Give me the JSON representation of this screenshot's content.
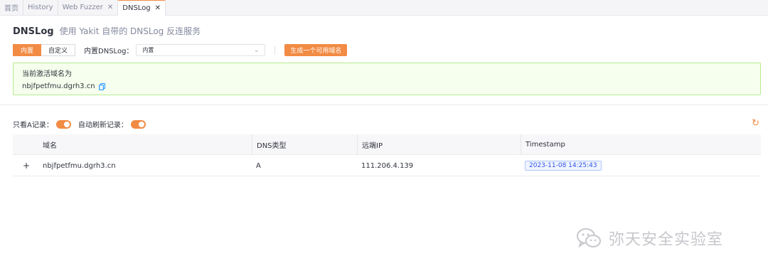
{
  "tabs": [
    {
      "label": "首页",
      "closable": false,
      "active": false
    },
    {
      "label": "History",
      "closable": false,
      "active": false
    },
    {
      "label": "Web Fuzzer",
      "closable": true,
      "active": false
    },
    {
      "label": "DNSLog",
      "closable": true,
      "active": true
    }
  ],
  "close_glyph": "✕",
  "header": {
    "title": "DNSLog",
    "subtitle": "使用 Yakit 自带的 DNSLog 反连服务"
  },
  "controls": {
    "mode_builtin": "内置",
    "mode_custom": "自定义",
    "select_label": "内置DNSLog：",
    "select_value": "内置",
    "generate_button": "生成一个可用域名"
  },
  "alert": {
    "title": "当前激活域名为",
    "domain": "nbjfpetfmu.dgrh3.cn"
  },
  "toggles": {
    "only_a_label": "只看A记录：",
    "only_a_on": true,
    "auto_refresh_label": "自动刷新记录：",
    "auto_refresh_on": true
  },
  "table": {
    "columns": [
      "域名",
      "DNS类型",
      "远端IP",
      "Timestamp"
    ],
    "rows": [
      {
        "expand": "+",
        "domain": "nbjfpetfmu.dgrh3.cn",
        "dns_type": "A",
        "remote_ip": "111.206.4.139",
        "timestamp": "2023-11-08 14:25:43"
      }
    ]
  },
  "watermark": {
    "text": "弥天安全实验室"
  },
  "colors": {
    "accent": "#f28b44",
    "success_bg": "#f6ffed",
    "success_border": "#b7eb8f",
    "tag_blue": "#2f54eb"
  }
}
